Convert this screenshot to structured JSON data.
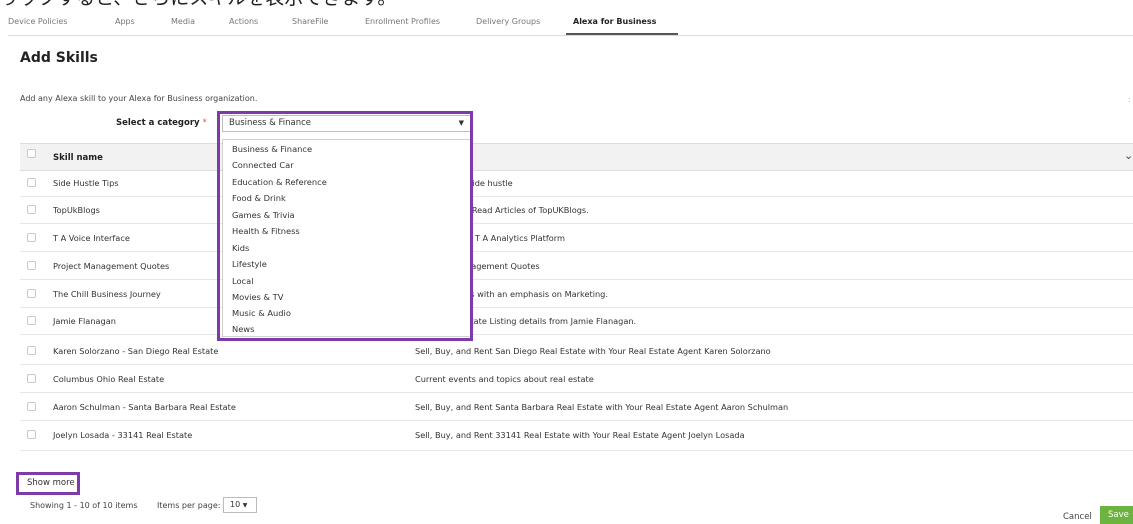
{
  "caption": "りックすると、さらにスキルを表示できます。",
  "tabs": [
    {
      "label": "Device Policies"
    },
    {
      "label": "Apps"
    },
    {
      "label": "Media"
    },
    {
      "label": "Actions"
    },
    {
      "label": "ShareFile"
    },
    {
      "label": "Enrollment Profiles"
    },
    {
      "label": "Delivery Groups"
    },
    {
      "label": "Alexa for Business"
    }
  ],
  "page": {
    "title": "Add Skills",
    "description": "Add any Alexa skill to your Alexa for Business organization."
  },
  "category": {
    "label": "Select a category",
    "required_mark": "*",
    "selected": "Business & Finance",
    "options": [
      "Business & Finance",
      "Connected Car",
      "Education & Reference",
      "Food & Drink",
      "Games & Trivia",
      "Health & Fitness",
      "Kids",
      "Lifestyle",
      "Local",
      "Movies & TV",
      "Music & Audio",
      "News"
    ]
  },
  "table": {
    "header_skill_name": "Skill name",
    "rows": [
      {
        "name": "Side Hustle Tips",
        "description": "ur side hustle"
      },
      {
        "name": "TopUkBlogs",
        "description": "to Read Articles of TopUKBlogs."
      },
      {
        "name": "T A Voice Interface",
        "description": "for T A Analytics Platform"
      },
      {
        "name": "Project Management Quotes",
        "description": "anagement Quotes"
      },
      {
        "name": "The Chill Business Journey",
        "description": "ess with an emphasis on Marketing."
      },
      {
        "name": "Jamie Flanagan",
        "description": "Estate Listing details from Jamie Flanagan."
      },
      {
        "name": "Karen Solorzano - San Diego Real Estate",
        "description": "Sell, Buy, and Rent San Diego Real Estate with Your Real Estate Agent Karen Solorzano"
      },
      {
        "name": "Columbus Ohio Real Estate",
        "description": "Current events and topics about real estate"
      },
      {
        "name": "Aaron Schulman - Santa Barbara Real Estate",
        "description": "Sell, Buy, and Rent Santa Barbara Real Estate with Your Real Estate Agent Aaron Schulman"
      },
      {
        "name": "Joelyn Losada - 33141 Real Estate",
        "description": "Sell, Buy, and Rent 33141 Real Estate with Your Real Estate Agent Joelyn Losada"
      }
    ]
  },
  "footer": {
    "show_more": "Show more",
    "showing": "Showing 1 - 10 of 10 items",
    "items_per_page_label": "Items per page:",
    "items_per_page_value": "10",
    "cancel": "Cancel",
    "save": "Save"
  },
  "colors": {
    "highlight": "#7e3aa8",
    "save_green": "#6cb33f",
    "required_red": "#d9534f"
  }
}
